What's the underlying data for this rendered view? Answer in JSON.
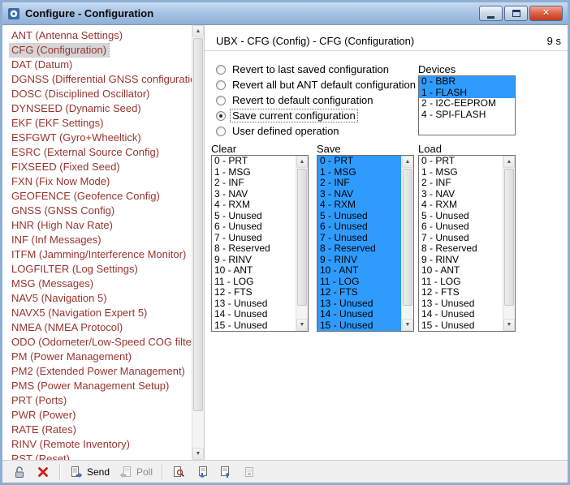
{
  "window": {
    "title": "Configure - Configuration",
    "timer": "9 s"
  },
  "icons": {
    "scroll_up": "▲",
    "scroll_down": "▼",
    "close_glyph": "✕"
  },
  "colors": {
    "selection_blue": "#2f9bfd",
    "sidebar_text": "#973530",
    "frame_blue": "#8fafd2"
  },
  "sidebar": {
    "selected_index": 1,
    "items": [
      "ANT (Antenna Settings)",
      "CFG (Configuration)",
      "DAT (Datum)",
      "DGNSS (Differential GNSS configuration)",
      "DOSC (Disciplined Oscillator)",
      "DYNSEED (Dynamic Seed)",
      "EKF (EKF Settings)",
      "ESFGWT (Gyro+Wheeltick)",
      "ESRC (External Source Config)",
      "FIXSEED (Fixed Seed)",
      "FXN (Fix Now Mode)",
      "GEOFENCE (Geofence Config)",
      "GNSS (GNSS Config)",
      "HNR (High Nav Rate)",
      "INF (Inf Messages)",
      "ITFM (Jamming/Interference Monitor)",
      "LOGFILTER (Log Settings)",
      "MSG (Messages)",
      "NAV5 (Navigation 5)",
      "NAVX5 (Navigation Expert 5)",
      "NMEA (NMEA Protocol)",
      "ODO (Odometer/Low-Speed COG filter)",
      "PM (Power Management)",
      "PM2 (Extended Power Management)",
      "PMS (Power Management Setup)",
      "PRT (Ports)",
      "PWR (Power)",
      "RATE (Rates)",
      "RINV (Remote Inventory)",
      "RST (Reset)"
    ]
  },
  "main": {
    "header": "UBX - CFG (Config) - CFG (Configuration)",
    "radio_options": [
      {
        "label": "Revert to last saved configuration",
        "checked": false
      },
      {
        "label": "Revert all but ANT default configuration",
        "checked": false
      },
      {
        "label": "Revert to default configuration",
        "checked": false
      },
      {
        "label": "Save current configuration",
        "checked": true
      },
      {
        "label": "User defined operation",
        "checked": false
      }
    ],
    "devices": {
      "label": "Devices",
      "items": [
        "0 - BBR",
        "1 - FLASH",
        "2 - I2C-EEPROM",
        "4 - SPI-FLASH"
      ],
      "selected_indices": [
        0,
        1
      ]
    },
    "action_lists": [
      {
        "label": "Clear",
        "selected_all": false
      },
      {
        "label": "Save",
        "selected_all": true
      },
      {
        "label": "Load",
        "selected_all": false
      }
    ],
    "config_items": [
      "0 - PRT",
      "1 - MSG",
      "2 - INF",
      "3 - NAV",
      "4 - RXM",
      "5 - Unused",
      "6 - Unused",
      "7 - Unused",
      "8 - Reserved",
      "9 - RINV",
      "10 - ANT",
      "11 - LOG",
      "12 - FTS",
      "13 - Unused",
      "14 - Unused",
      "15 - Unused"
    ]
  },
  "toolbar": {
    "send_label": "Send",
    "poll_label": "Poll"
  }
}
